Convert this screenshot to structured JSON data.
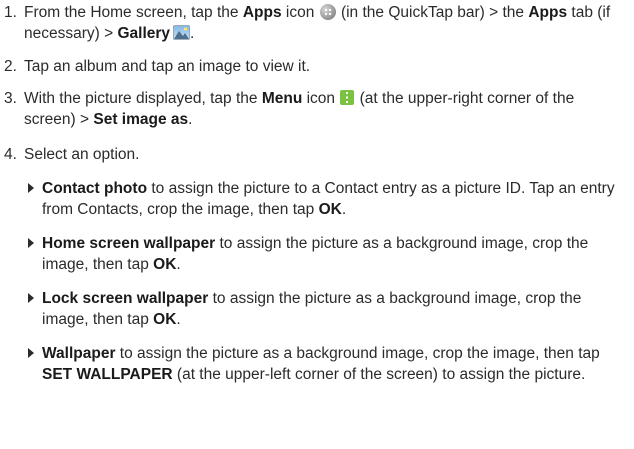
{
  "steps": [
    {
      "num": "1.",
      "p1": "From the Home screen, tap the ",
      "b1": "Apps",
      "p2": " icon ",
      "p3": " (in the QuickTap bar) > the ",
      "b2": "Apps",
      "p4": " tab (if necessary) > ",
      "b3": "Gallery",
      "p5": "."
    },
    {
      "num": "2.",
      "p1": "Tap an album and tap an image to view it."
    },
    {
      "num": "3.",
      "p1": "With the picture displayed, tap the ",
      "b1": "Menu",
      "p2": " icon ",
      "p3": " (at the upper-right corner of the screen) > ",
      "b2": "Set image as",
      "p4": "."
    },
    {
      "num": "4.",
      "p1": "Select an option."
    }
  ],
  "options": [
    {
      "b": "Contact photo",
      "p1": " to assign the picture to a Contact entry as a picture ID. Tap an entry from Contacts, crop the image, then tap ",
      "b2": "OK",
      "p2": "."
    },
    {
      "b": "Home screen wallpaper",
      "p1": " to assign the picture as a background image, crop the image, then tap ",
      "b2": "OK",
      "p2": "."
    },
    {
      "b": "Lock screen wallpaper",
      "p1": " to assign the picture as a background image, crop the image, then tap ",
      "b2": "OK",
      "p2": "."
    },
    {
      "b": "Wallpaper",
      "p1": " to assign the picture as a background image, crop the image, then tap ",
      "b2": "SET WALLPAPER",
      "p2": " (at the upper-left corner of the screen) to assign the picture."
    }
  ],
  "icons": {
    "apps": "apps-icon",
    "gallery": "gallery-icon",
    "menu": "menu-icon"
  },
  "colors": {
    "text": "#2b2b2b",
    "menu_icon": "#7cc242"
  }
}
